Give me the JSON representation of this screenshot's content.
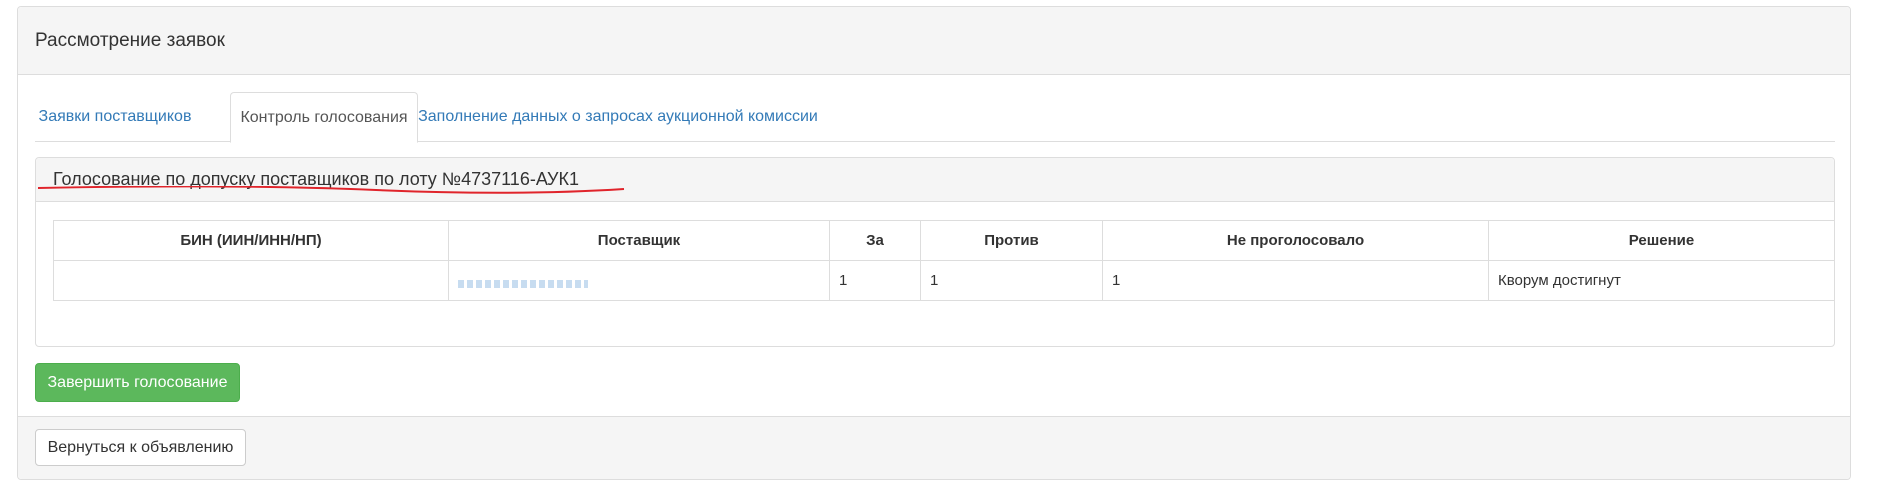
{
  "panel": {
    "title": "Рассмотрение заявок"
  },
  "tabs": [
    {
      "label": "Заявки поставщиков",
      "active": false
    },
    {
      "label": "Контроль голосования",
      "active": true
    },
    {
      "label": "Заполнение данных о запросах аукционной комиссии",
      "active": false
    }
  ],
  "voting": {
    "title": "Голосование по допуску поставщиков по лоту №4737116-АУК1",
    "annotation_color": "#e0242b",
    "table": {
      "headers": [
        "БИН (ИИН/ИНН/НП)",
        "Поставщик",
        "За",
        "Против",
        "Не проголосовало",
        "Решение"
      ],
      "rows": [
        {
          "bin": "",
          "supplier": "",
          "for": "1",
          "against": "1",
          "not_voted": "1",
          "decision": "Кворум достигнут"
        }
      ]
    }
  },
  "actions": {
    "finish_voting": "Завершить голосование",
    "back": "Вернуться к объявлению"
  },
  "colors": {
    "link": "#337ab7",
    "success": "#5cb85c",
    "border": "#dddddd",
    "heading_bg": "#f5f5f5"
  }
}
